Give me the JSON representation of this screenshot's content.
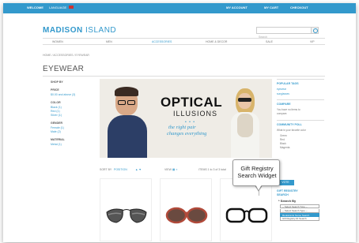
{
  "topbar": {
    "welcome": "WELCOME",
    "language": "LANGUAGE",
    "account": "MY ACCOUNT",
    "cart": "MY CART",
    "checkout": "CHECKOUT"
  },
  "header": {
    "logo_a": "MADISON",
    "logo_b": " ISLAND",
    "search_placeholder": "Search"
  },
  "nav": {
    "items": [
      "WOMEN",
      "MEN",
      "ACCESSORIES",
      "HOME & DECOR",
      "SALE",
      "VIP"
    ],
    "active_index": 2
  },
  "breadcrumb": "HOME / ACCESSORIES / EYEWEAR",
  "page_title": "EYEWEAR",
  "sidebar": {
    "shop_by": "SHOP BY",
    "price_h": "PRICE",
    "price_v": "$0.00 and above (3)",
    "color_h": "COLOR",
    "color_1": "Black (1)",
    "color_2": "Red (1)",
    "color_3": "Silver (1)",
    "gender_h": "GENDER",
    "gender_1": "Female (1)",
    "gender_2": "Male (2)",
    "material_h": "MATERIAL",
    "material_1": "Metal (1)"
  },
  "banner": {
    "title": "OPTICAL",
    "subtitle": "ILLUSIONS",
    "dots": "• • •",
    "tag1": "the right pair",
    "tag2": "changes everything"
  },
  "toolbar": {
    "sort_label": "SORT BY",
    "sort_value": "POSITION",
    "arrows": "▲ ▼",
    "view_label": "VIEW",
    "view_value": "▦ ≡",
    "items": "ITEMS 1 to 3 of 3 total"
  },
  "right_sidebar": {
    "popular_h": "POPULAR TAGS",
    "tag1": "eyewear",
    "tag2": "sunglasses",
    "compare_h": "COMPARE",
    "compare_p1": "You have no items to",
    "compare_p2": "compare.",
    "poll_h": "COMMUNITY POLL",
    "poll_q1": "What is your favorite color",
    "poll_o1": "Green",
    "poll_o2": "Red",
    "poll_o3": "Black",
    "poll_o4": "Magenta",
    "vote": "VOTE"
  },
  "registry": {
    "heading_1": "GIFT REGISTRY",
    "heading_2": "SEARCH",
    "search_by": "* Search By",
    "select": "-- Select Search Type --",
    "option_1": "Registrants Name Search",
    "option_2": "Gift Registry ID Search"
  },
  "callout": {
    "line1": "Gift Registry",
    "line2": "Search Widget"
  },
  "colors": {
    "brand": "#3399cc"
  }
}
